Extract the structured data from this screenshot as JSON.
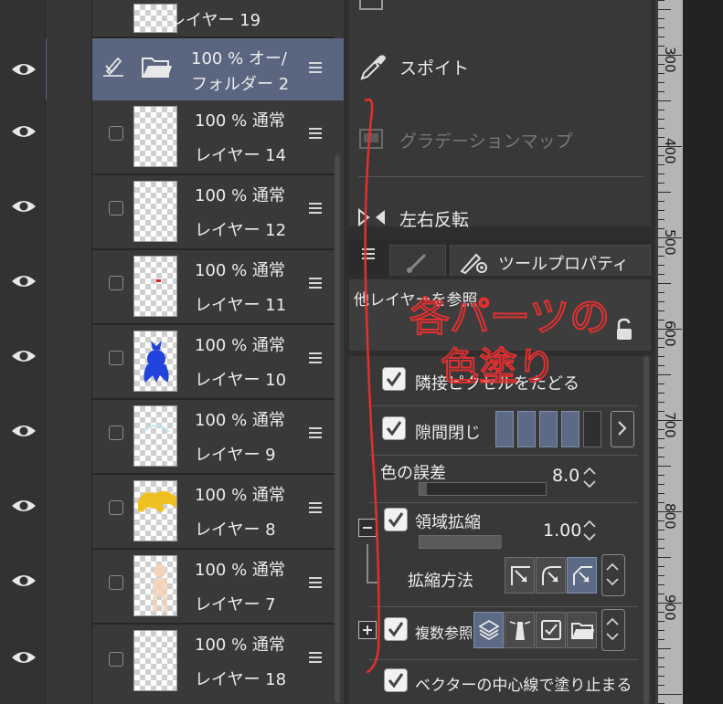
{
  "layer_panel": {
    "layers": [
      {
        "kind": "layer",
        "top": null,
        "name": "レイヤー 19",
        "info": ""
      },
      {
        "kind": "folder",
        "info": "100 % オー/",
        "name": "フォルダー 2"
      },
      {
        "kind": "layer",
        "info": "100 % 通常",
        "name": "レイヤー 14"
      },
      {
        "kind": "layer",
        "info": "100 % 通常",
        "name": "レイヤー 12"
      },
      {
        "kind": "layer",
        "info": "100 % 通常",
        "name": "レイヤー 11"
      },
      {
        "kind": "layer",
        "info": "100 % 通常",
        "name": "レイヤー 10"
      },
      {
        "kind": "layer",
        "info": "100 % 通常",
        "name": "レイヤー 9"
      },
      {
        "kind": "layer",
        "info": "100 % 通常",
        "name": "レイヤー 8"
      },
      {
        "kind": "layer",
        "info": "100 % 通常",
        "name": "レイヤー 7"
      },
      {
        "kind": "layer",
        "info": "100 % 通常",
        "name": "レイヤー 18"
      }
    ]
  },
  "sub_tools": {
    "eyedropper": "スポイト",
    "gradient_map": "グラデーションマップ",
    "flip_horizontal": "左右反転"
  },
  "tool_property": {
    "tab_label": "ツールプロパティ",
    "reference_mode": "他レイヤーを参照",
    "follow_adjacent": "隣接ピクセルをたどる",
    "close_gap": "隙間閉じ",
    "color_margin_label": "色の誤差",
    "color_margin_value": "8.0",
    "area_scaling_label": "領域拡縮",
    "area_scaling_value": "1.00",
    "scaling_method_label": "拡縮方法",
    "multi_reference_label": "複数参照",
    "vector_centerline": "ベクターの中心線で塗り止まる"
  },
  "ruler": {
    "labels": [
      "300",
      "400",
      "500",
      "600",
      "700",
      "800",
      "900"
    ]
  },
  "annotation": {
    "line1": "各パーツの",
    "line2": "色塗り"
  },
  "colors": {
    "selected_row": "#5a6680",
    "accent_blue": "#5d6a85",
    "annotation_red": "#e23030"
  }
}
